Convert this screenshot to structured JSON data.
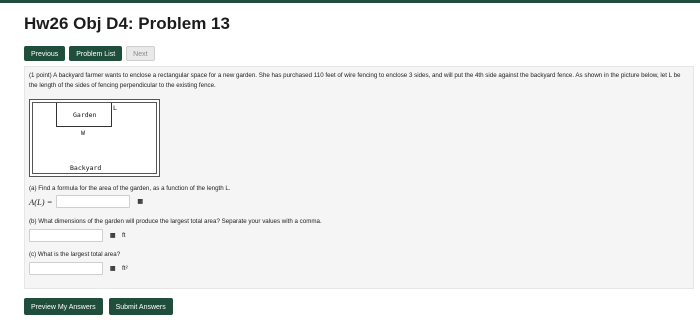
{
  "page": {
    "title": "Hw26 Obj D4: Problem 13"
  },
  "nav": {
    "previous": "Previous",
    "problem_list": "Problem List",
    "next": "Next"
  },
  "problem": {
    "text": "(1 point) A backyard farmer wants to enclose a rectangular space for a new garden. She has purchased 110 feet of wire fencing to enclose 3 sides, and will put the 4th side against the backyard fence. As shown in the picture below, let L be the length of the sides of fencing perpendicular to the existing fence.",
    "figure": {
      "garden_label": "Garden",
      "w_label": "W",
      "l_label": "L",
      "backyard_label": "Backyard"
    },
    "part_a": {
      "question": "(a) Find a formula for the area of the garden, as a function of the length L.",
      "lhs": "A(L) =",
      "value": "",
      "icon": "grid-icon"
    },
    "part_b": {
      "question": "(b) What dimensions of the garden will produce the largest total area? Separate your values with a comma.",
      "value": "",
      "unit": "ft",
      "icon": "grid-icon"
    },
    "part_c": {
      "question": "(c) What is the largest total area?",
      "value": "",
      "unit": "ft²",
      "icon": "grid-icon"
    }
  },
  "actions": {
    "preview": "Preview My Answers",
    "submit": "Submit Answers"
  },
  "colors": {
    "primary": "#1f4e3d",
    "panel_bg": "#f5f5f5"
  }
}
